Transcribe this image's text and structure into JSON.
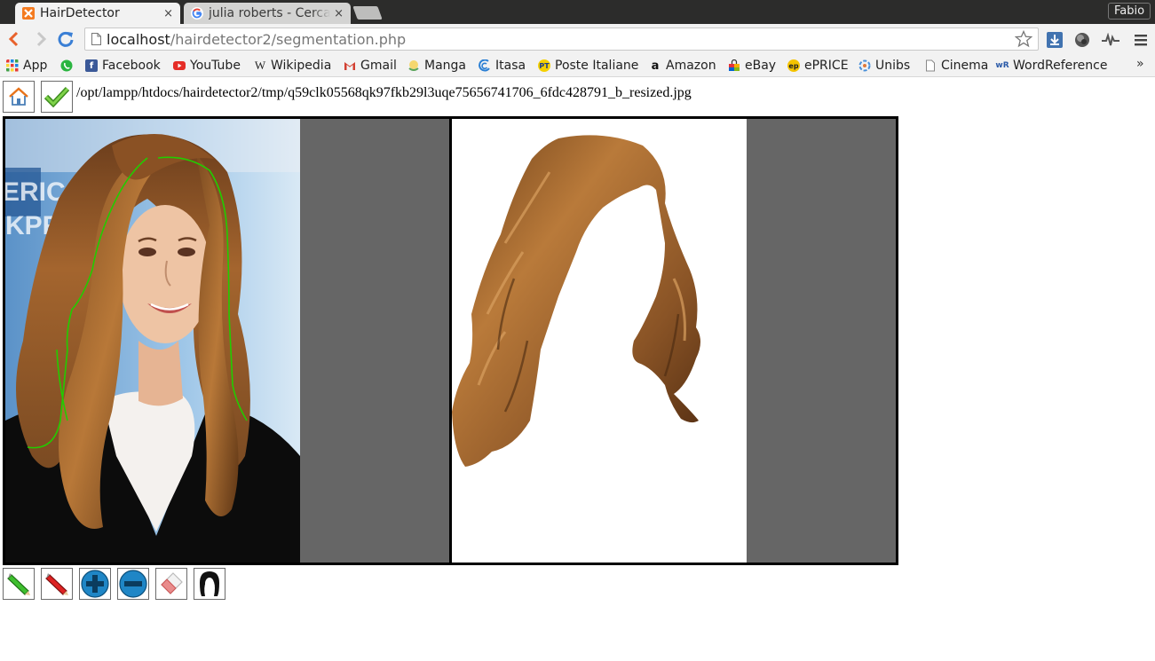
{
  "browser": {
    "tabs": [
      {
        "title": "HairDetector",
        "active": true,
        "favicon": "xampp-icon"
      },
      {
        "title": "julia roberts - Cerca con Google",
        "active": false,
        "favicon": "google-icon"
      }
    ],
    "close_glyph": "×",
    "profile_name": "Fabio",
    "url_host": "localhost",
    "url_path": "/hairdetector2/segmentation.php",
    "bookmarks": [
      {
        "label": "App",
        "icon": "apps-grid-icon"
      },
      {
        "label": "Facebook",
        "icon": "facebook-icon"
      },
      {
        "label": "YouTube",
        "icon": "youtube-icon"
      },
      {
        "label": "Wikipedia",
        "icon": "wikipedia-icon"
      },
      {
        "label": "Gmail",
        "icon": "gmail-icon"
      },
      {
        "label": "Manga",
        "icon": "manga-icon"
      },
      {
        "label": "Itasa",
        "icon": "itasa-icon"
      },
      {
        "label": "Poste Italiane",
        "icon": "poste-icon"
      },
      {
        "label": "Amazon",
        "icon": "amazon-icon"
      },
      {
        "label": "eBay",
        "icon": "ebay-icon"
      },
      {
        "label": "ePRICE",
        "icon": "eprice-icon"
      },
      {
        "label": "Unibs",
        "icon": "unibs-icon"
      },
      {
        "label": "Cinema",
        "icon": "page-icon"
      },
      {
        "label": "WordReference",
        "icon": "wordreference-icon"
      }
    ],
    "bookmarks_overflow": "»"
  },
  "page": {
    "file_path": "/opt/lampp/htdocs/hairdetector2/tmp/q59clk05568qk97fkb29l3uqe75656741706_6fdc428791_b_resized.jpg",
    "top_buttons": [
      "home-icon",
      "confirm-check-icon"
    ],
    "tools": [
      "green-pencil-icon",
      "red-pencil-icon",
      "zoom-in-icon",
      "zoom-out-icon",
      "eraser-icon",
      "hair-silhouette-icon"
    ],
    "colors": {
      "canvas_background": "#666666",
      "foreground_stroke": "#22cc00",
      "background_stroke": "#dd2222",
      "tab_strip": "#2c2c2b"
    }
  }
}
